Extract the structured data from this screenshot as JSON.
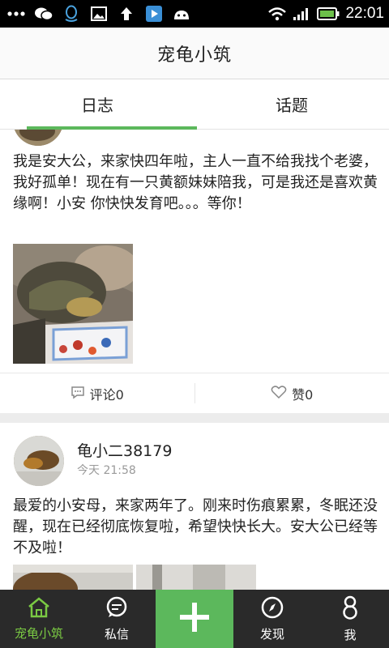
{
  "status_bar": {
    "time": "22:01",
    "icons": [
      "more-dots-icon",
      "wechat-icon",
      "qq-icon",
      "image-icon",
      "upload-arrow-icon",
      "play-store-icon",
      "android-icon",
      "wifi-icon",
      "signal-icon",
      "battery-icon"
    ]
  },
  "app": {
    "title": "宠龟小筑"
  },
  "tabs": [
    {
      "label": "日志",
      "active": true
    },
    {
      "label": "话题",
      "active": false
    }
  ],
  "posts": [
    {
      "text": "我是安大公，来家快四年啦，主人一直不给我找个老婆，我好孤单！现在有一只黄额妹妹陪我，可是我还是喜欢黄缘啊！小安 你快快发育吧。。。等你！",
      "comment_label": "评论0",
      "like_label": "赞0"
    },
    {
      "username": "龟小二38179",
      "time": "今天 21:58",
      "text": "最爱的小安母，来家两年了。刚来时伤痕累累，冬眠还没醒，现在已经彻底恢复啦，希望快快长大。安大公已经等不及啦！"
    }
  ],
  "bottom_nav": {
    "home": "宠龟小筑",
    "messages": "私信",
    "discover": "发现",
    "me": "我"
  },
  "colors": {
    "accent": "#5cb85c",
    "nav_bg": "#2a2a2a",
    "active_nav": "#7ac943"
  }
}
